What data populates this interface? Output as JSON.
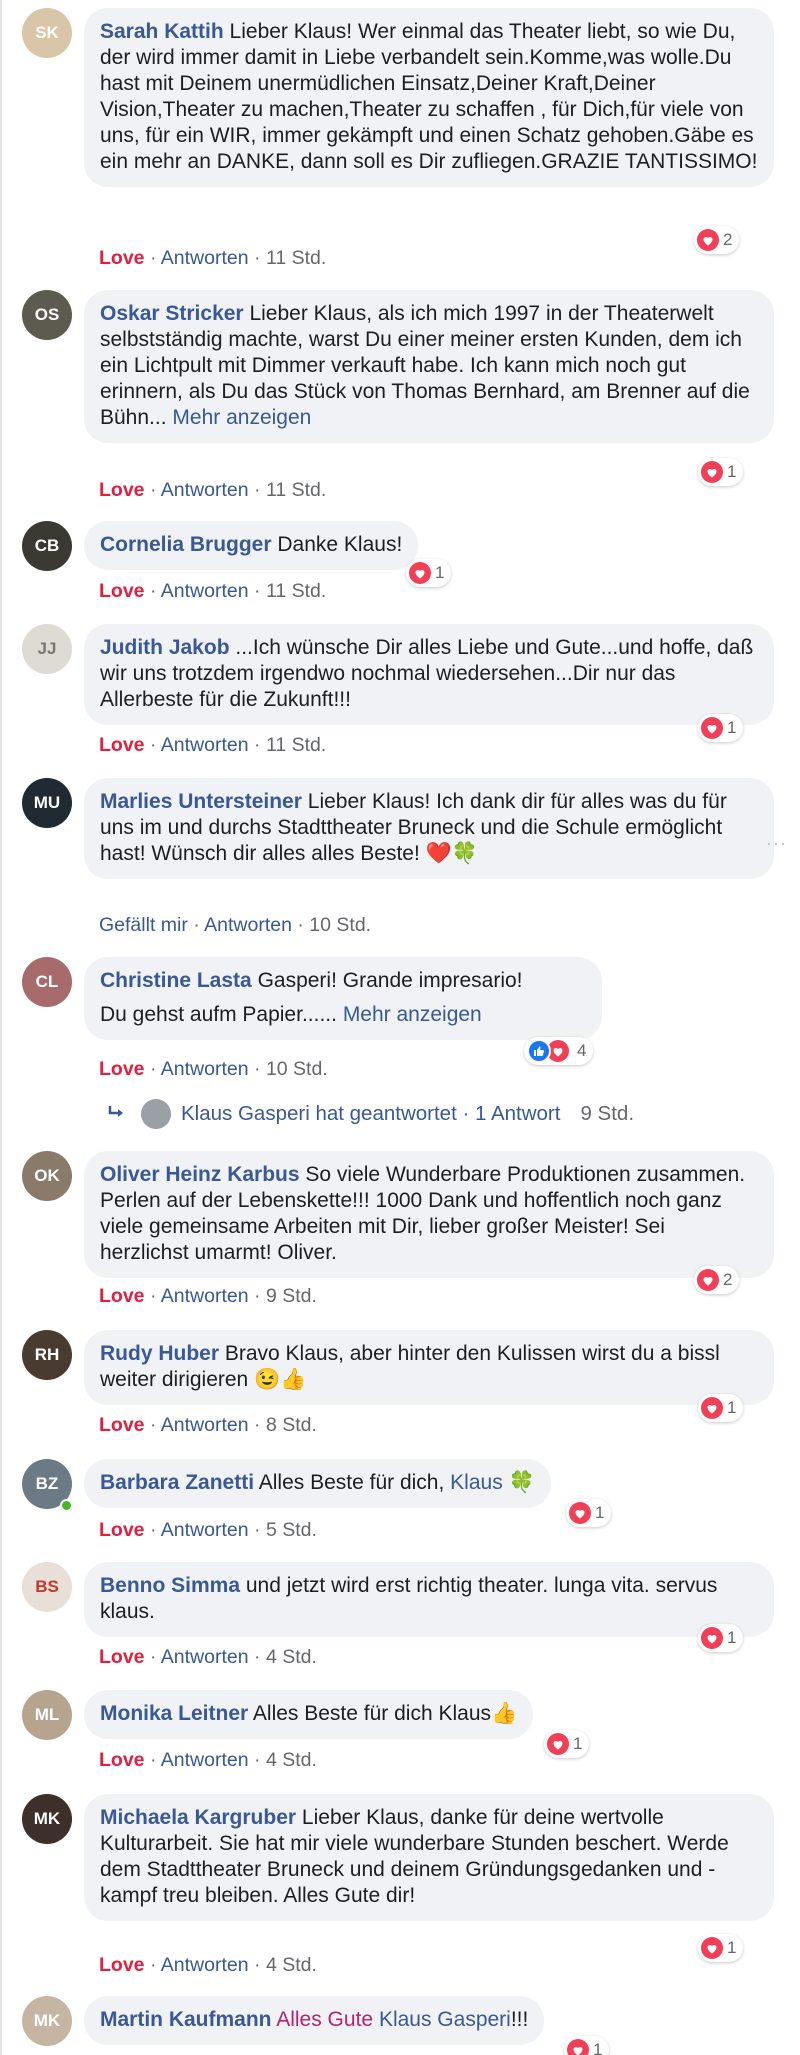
{
  "comments": [
    {
      "author": "Sarah Kattih",
      "text": "Lieber Klaus! Wer einmal das Theater liebt, so wie Du, der wird immer damit in Liebe verbandelt sein.Komme,was wolle.Du hast mit Deinem unermüdlichen Einsatz,Deiner Kraft,Deiner Vision,Theater zu machen,Theater zu schaffen , für Dich,für viele von uns, für ein WIR, immer gekämpft und einen Schatz gehoben.Gäbe es ein mehr an DANKE, dann soll es Dir zufliegen.GRAZIE TANTISSIMO!",
      "reaction_label": "Love",
      "reply_label": "Antworten",
      "time": "11 Std.",
      "reaction_count": "2",
      "avatar_color": "#d9c6a8"
    },
    {
      "author": "Oskar Stricker",
      "text": "Lieber Klaus, als ich mich 1997 in der Theaterwelt selbstständig machte, warst Du einer meiner ersten Kunden, dem ich ein Lichtpult mit Dimmer verkauft habe. Ich kann mich noch gut erinnern, als Du das Stück von Thomas Bernhard, am Brenner auf die Bühn...",
      "more": "Mehr anzeigen",
      "reaction_label": "Love",
      "reply_label": "Antworten",
      "time": "11 Std.",
      "reaction_count": "1",
      "avatar_color": "#5d5a4f"
    },
    {
      "author": "Cornelia Brugger",
      "text": "Danke Klaus!",
      "reaction_label": "Love",
      "reply_label": "Antworten",
      "time": "11 Std.",
      "reaction_count": "1",
      "avatar_color": "#3a3a32"
    },
    {
      "author": "Judith Jakob",
      "text": "...Ich wünsche Dir alles Liebe und Gute...und hoffe, daß wir uns trotzdem irgendwo nochmal wiedersehen...Dir nur das Allerbeste für die Zukunft!!!",
      "reaction_label": "Love",
      "reply_label": "Antworten",
      "time": "11 Std.",
      "reaction_count": "1",
      "avatar_color": "#dedbd5"
    },
    {
      "author": "Marlies Untersteiner",
      "text": "Lieber Klaus! Ich dank dir für alles was du für uns im und durchs Stadttheater Bruneck und die Schule ermöglicht hast! Wünsch dir alles alles Beste! ❤️🍀",
      "reaction_label": "Gefällt mir",
      "reply_label": "Antworten",
      "time": "10 Std.",
      "avatar_color": "#1f2a33"
    },
    {
      "author": "Christine Lasta",
      "text": "Gasperi! Grande impresario!",
      "text2": "Du gehst aufm Papier......",
      "more": "Mehr anzeigen",
      "reaction_label": "Love",
      "reply_label": "Antworten",
      "time": "10 Std.",
      "reaction_count": "4",
      "avatar_color": "#a76b6b"
    },
    {
      "author": "Oliver Heinz Karbus",
      "text": "So viele Wunderbare Produktionen zusammen. Perlen auf der Lebenskette!!! 1000 Dank und hoffentlich noch ganz viele gemeinsame Arbeiten mit Dir, lieber großer Meister! Sei herzlichst umarmt! Oliver.",
      "reaction_label": "Love",
      "reply_label": "Antworten",
      "time": "9 Std.",
      "reaction_count": "2",
      "avatar_color": "#8a7a6a"
    },
    {
      "author": "Rudy Huber",
      "text": "Bravo Klaus, aber hinter den Kulissen wirst du a bissl weiter dirigieren 😉👍",
      "reaction_label": "Love",
      "reply_label": "Antworten",
      "time": "8 Std.",
      "reaction_count": "1",
      "avatar_color": "#4a3b30"
    },
    {
      "author": "Barbara Zanetti",
      "text": "Alles Beste für dich,",
      "mention": "Klaus",
      "emoji": "🍀",
      "reaction_label": "Love",
      "reply_label": "Antworten",
      "time": "5 Std.",
      "reaction_count": "1",
      "avatar_color": "#6c7a86"
    },
    {
      "author": "Benno Simma",
      "text": "und jetzt wird erst richtig theater. lunga vita. servus klaus.",
      "reaction_label": "Love",
      "reply_label": "Antworten",
      "time": "4 Std.",
      "reaction_count": "1",
      "avatar_color": "#e8e0d8"
    },
    {
      "author": "Monika Leitner",
      "text": "Alles Beste für dich Klaus👍",
      "reaction_label": "Love",
      "reply_label": "Antworten",
      "time": "4 Std.",
      "reaction_count": "1",
      "avatar_color": "#b6a48f"
    },
    {
      "author": "Michaela Kargruber",
      "text": "Lieber Klaus, danke für deine wertvolle Kulturarbeit. Sie hat mir viele wunderbare Stunden beschert. Werde dem Stadttheater Bruneck und deinem Gründungsgedanken und - kampf treu bleiben. Alles Gute dir!",
      "reaction_label": "Love",
      "reply_label": "Antworten",
      "time": "4 Std.",
      "reaction_count": "1",
      "avatar_color": "#3d2f2a"
    },
    {
      "author": "Martin Kaufmann",
      "text_colored": "Alles Gute",
      "mention": "Klaus Gasperi",
      "text_end": "!!!",
      "reaction_count": "1",
      "avatar_color": "#c7b5a3"
    }
  ],
  "reply_thread": {
    "text": "Klaus Gasperi hat geantwortet · 1 Antwort",
    "time": "9 Std."
  },
  "separator": "·",
  "more_dots": "···"
}
